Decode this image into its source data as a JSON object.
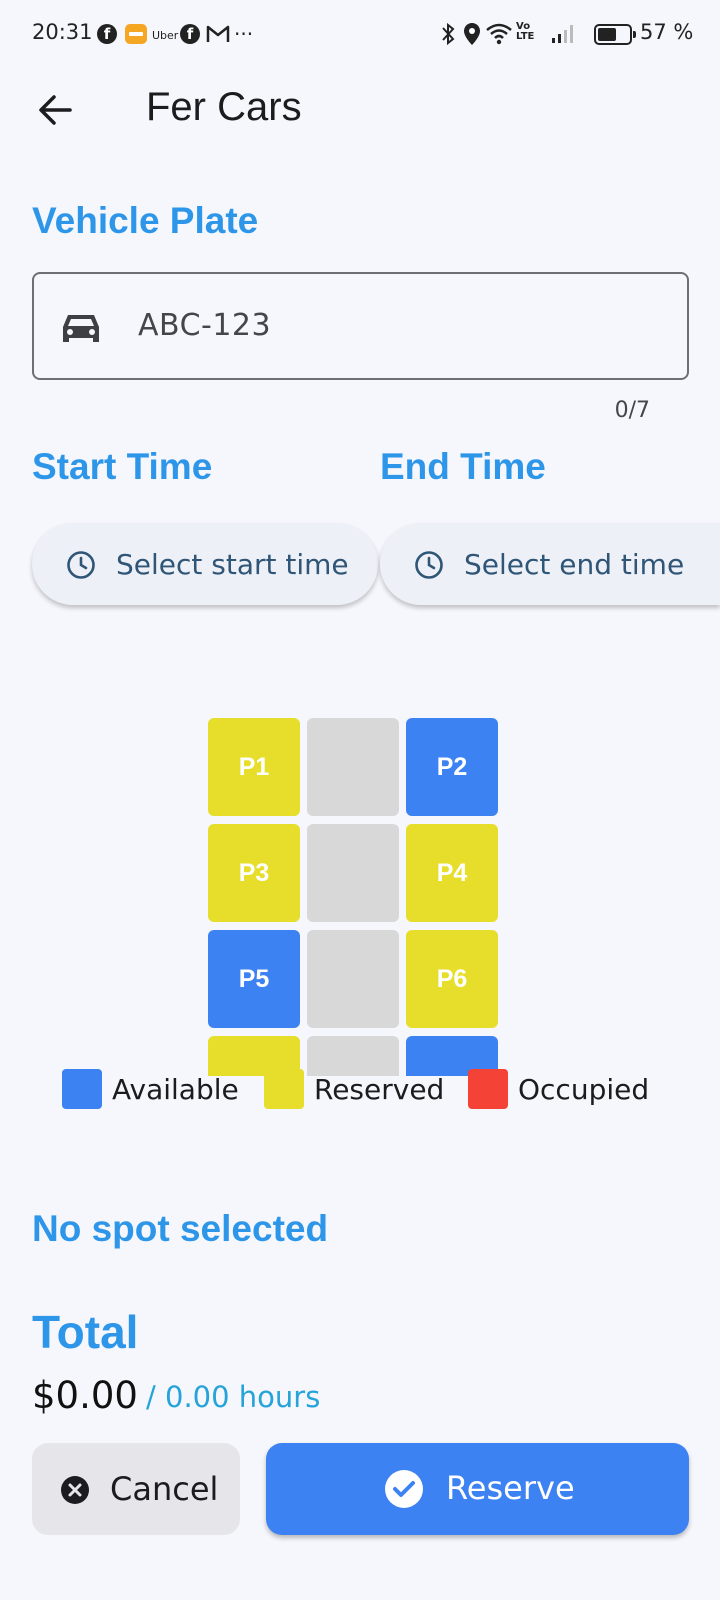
{
  "status_bar": {
    "time": "20:31",
    "uber_label": "Uber",
    "battery": "57 %",
    "volte_top": "Vo",
    "volte_bottom": "LTE",
    "more": "···"
  },
  "app_bar": {
    "title": "Fer Cars"
  },
  "vehicle": {
    "section_title": "Vehicle Plate",
    "plate_value": "ABC-123",
    "counter": "0/7"
  },
  "time": {
    "start_title": "Start Time",
    "end_title": "End Time",
    "start_button": "Select start time",
    "end_button": "Select end time"
  },
  "parking": {
    "spots": [
      {
        "label": "P1",
        "status": "reserved"
      },
      {
        "label": "P2",
        "status": "available"
      },
      {
        "label": "P3",
        "status": "reserved"
      },
      {
        "label": "P4",
        "status": "reserved"
      },
      {
        "label": "P5",
        "status": "available"
      },
      {
        "label": "P6",
        "status": "reserved"
      },
      {
        "label": "",
        "status": "reserved"
      },
      {
        "label": "",
        "status": "available"
      }
    ]
  },
  "legend": [
    {
      "label": "Available",
      "color": "#3d82f3"
    },
    {
      "label": "Reserved",
      "color": "#e6de2b"
    },
    {
      "label": "Occupied",
      "color": "#f44336"
    }
  ],
  "selection": {
    "status": "No spot selected"
  },
  "total": {
    "title": "Total",
    "price": "$0.00",
    "hours": "/ 0.00 hours"
  },
  "actions": {
    "cancel": "Cancel",
    "reserve": "Reserve"
  },
  "colors": {
    "accent": "#2e96e9",
    "primary_button": "#3d82f3",
    "reserved": "#e6de2b",
    "available": "#3d82f3",
    "occupied": "#f44336",
    "lane": "#d8d8d8"
  }
}
